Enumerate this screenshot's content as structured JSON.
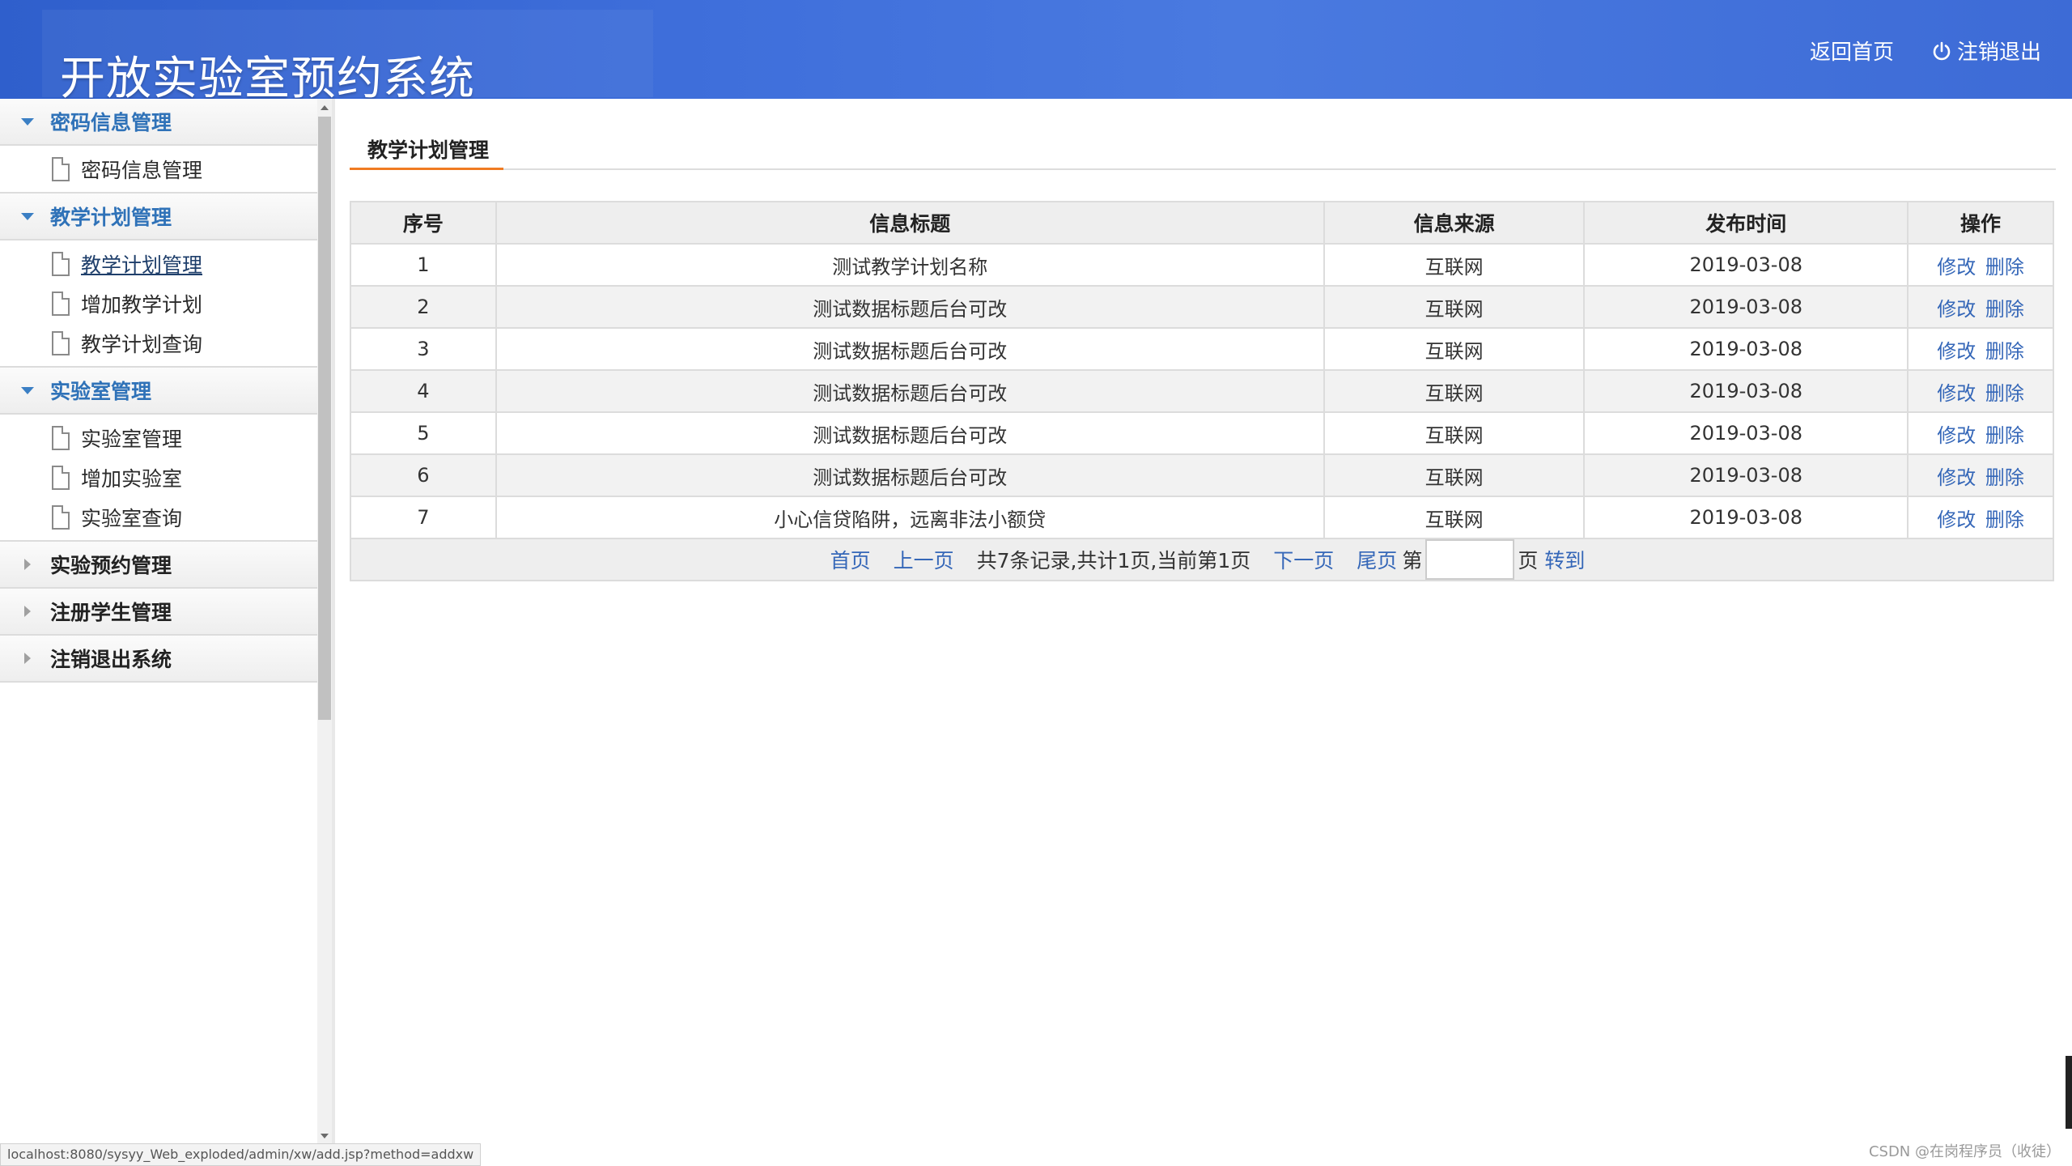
{
  "header": {
    "title": "开放实验室预约系统",
    "home_link": "返回首页",
    "logout_link": "注销退出",
    "logout_icon": "power-icon"
  },
  "sidebar": {
    "groups": [
      {
        "label": "密码信息管理",
        "expanded": true,
        "items": [
          {
            "label": "密码信息管理"
          }
        ]
      },
      {
        "label": "教学计划管理",
        "expanded": true,
        "items": [
          {
            "label": "教学计划管理",
            "active": true
          },
          {
            "label": "增加教学计划"
          },
          {
            "label": "教学计划查询"
          }
        ]
      },
      {
        "label": "实验室管理",
        "expanded": true,
        "items": [
          {
            "label": "实验室管理"
          },
          {
            "label": "增加实验室"
          },
          {
            "label": "实验室查询"
          }
        ]
      },
      {
        "label": "实验预约管理",
        "expanded": false,
        "items": []
      },
      {
        "label": "注册学生管理",
        "expanded": false,
        "items": []
      },
      {
        "label": "注销退出系统",
        "expanded": false,
        "items": []
      }
    ]
  },
  "main": {
    "tab_title": "教学计划管理",
    "table": {
      "columns": [
        "序号",
        "信息标题",
        "信息来源",
        "发布时间",
        "操作"
      ],
      "rows": [
        {
          "no": "1",
          "title": "测试教学计划名称",
          "source": "互联网",
          "date": "2019-03-08"
        },
        {
          "no": "2",
          "title": "测试数据标题后台可改",
          "source": "互联网",
          "date": "2019-03-08"
        },
        {
          "no": "3",
          "title": "测试数据标题后台可改",
          "source": "互联网",
          "date": "2019-03-08"
        },
        {
          "no": "4",
          "title": "测试数据标题后台可改",
          "source": "互联网",
          "date": "2019-03-08"
        },
        {
          "no": "5",
          "title": "测试数据标题后台可改",
          "source": "互联网",
          "date": "2019-03-08"
        },
        {
          "no": "6",
          "title": "测试数据标题后台可改",
          "source": "互联网",
          "date": "2019-03-08"
        },
        {
          "no": "7",
          "title": "小心信贷陷阱，远离非法小额贷",
          "source": "互联网",
          "date": "2019-03-08"
        }
      ],
      "edit_label": "修改",
      "delete_label": "删除"
    },
    "pager": {
      "first": "首页",
      "prev": "上一页",
      "info": "共7条记录,共计1页,当前第1页",
      "next": "下一页",
      "last": "尾页",
      "page_prefix": "第",
      "page_input_value": "",
      "page_suffix": "页",
      "go": "转到"
    }
  },
  "status_bar": {
    "url": "localhost:8080/sysyy_Web_exploded/admin/xw/add.jsp?method=addxw"
  },
  "watermark": "CSDN @在岗程序员（收徒）",
  "colors": {
    "header_blue": "#3f6fdb",
    "link_blue": "#3567b8",
    "tab_accent": "#f07b22"
  }
}
